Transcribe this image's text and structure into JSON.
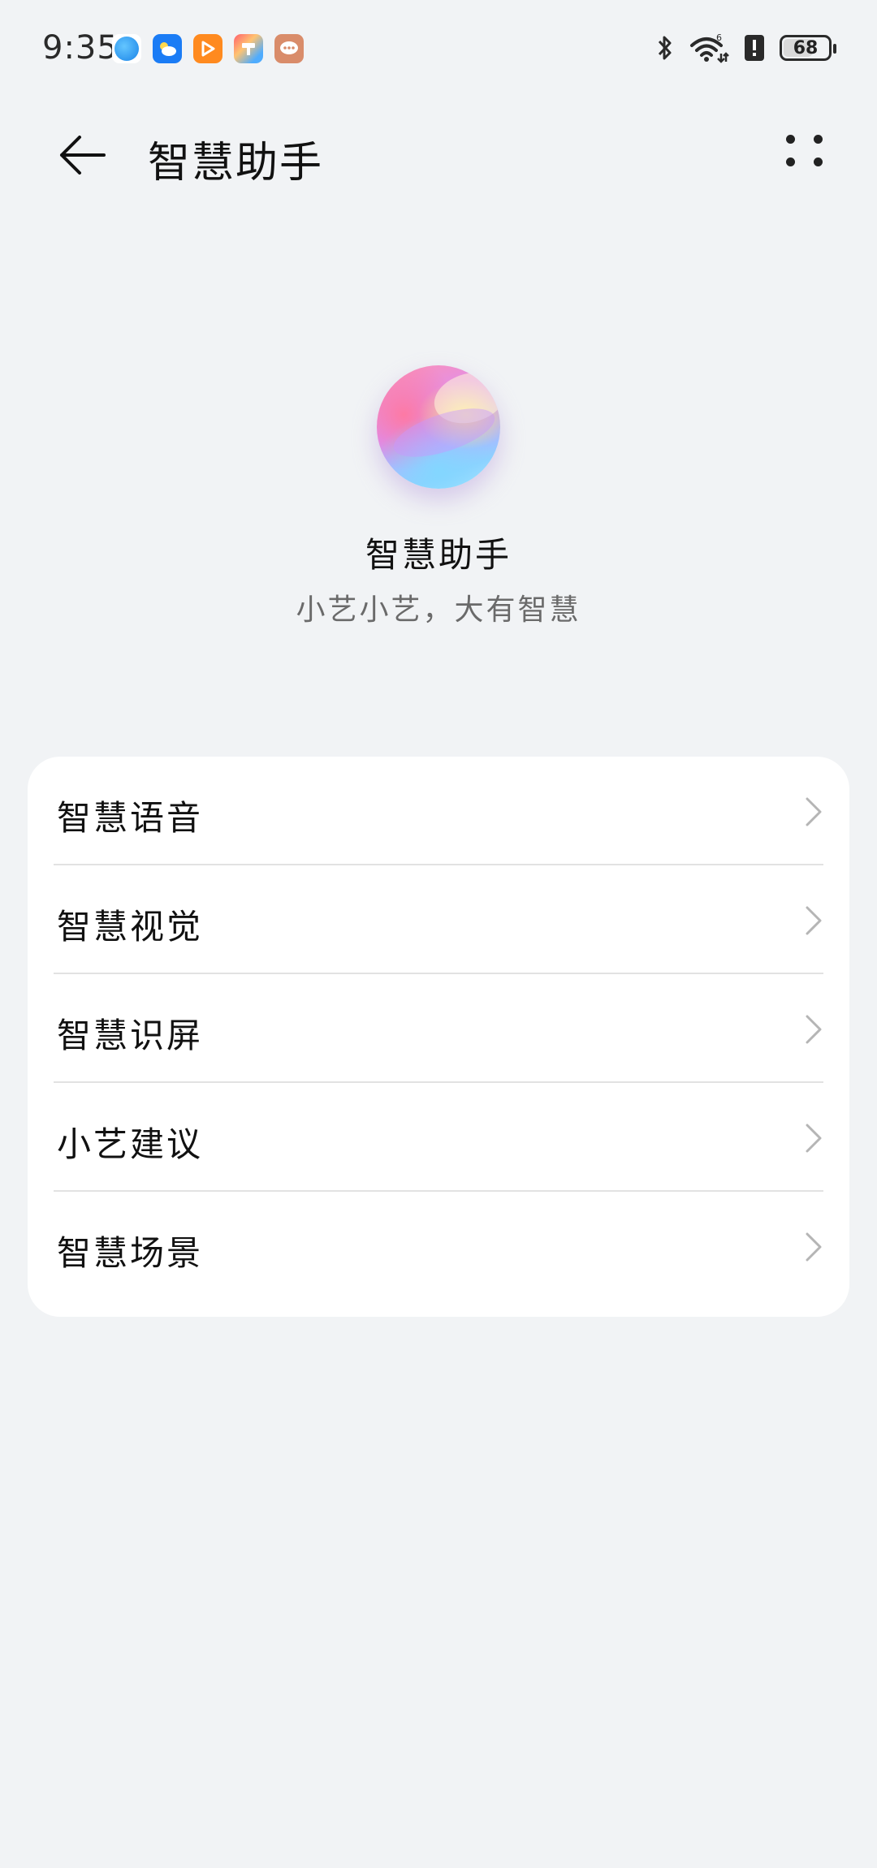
{
  "status_bar": {
    "time": "9:35",
    "notification_icons": [
      "browser-icon",
      "weather-icon",
      "video-icon",
      "app-market-icon",
      "messaging-icon"
    ],
    "battery_level": "68",
    "battery_fraction": 0.68,
    "signal_label": "6"
  },
  "title_bar": {
    "title": "智慧助手"
  },
  "hero": {
    "title": "智慧助手",
    "subtitle": "小艺小艺，大有智慧"
  },
  "menu": {
    "items": [
      {
        "label": "智慧语音"
      },
      {
        "label": "智慧视觉"
      },
      {
        "label": "智慧识屏"
      },
      {
        "label": "小艺建议"
      },
      {
        "label": "智慧场景"
      }
    ]
  },
  "colors": {
    "background": "#f1f3f5",
    "card": "#ffffff",
    "text_primary": "#111111",
    "text_secondary": "#6a6a6a",
    "divider": "#e2e2e2",
    "chevron": "#b5b5b5"
  }
}
